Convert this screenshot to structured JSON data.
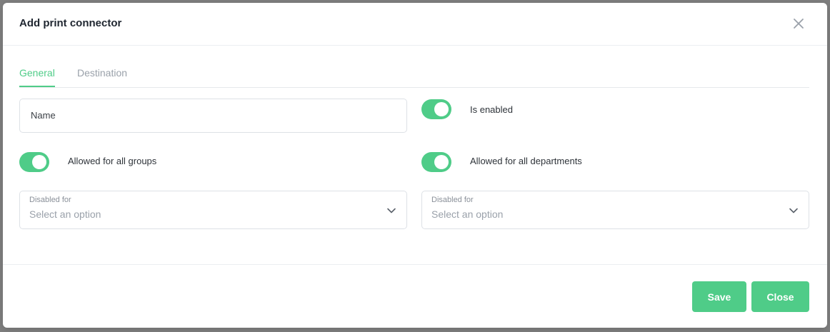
{
  "modal": {
    "title": "Add print connector"
  },
  "tabs": [
    {
      "label": "General",
      "active": true
    },
    {
      "label": "Destination",
      "active": false
    }
  ],
  "form": {
    "name_placeholder": "Name",
    "name_value": "",
    "toggles": {
      "is_enabled": {
        "label": "Is enabled",
        "on": true
      },
      "allowed_all_groups": {
        "label": "Allowed for all groups",
        "on": true
      },
      "allowed_all_departments": {
        "label": "Allowed for all departments",
        "on": true
      }
    },
    "groups_select": {
      "label": "Disabled for",
      "placeholder": "Select an option"
    },
    "departments_select": {
      "label": "Disabled for",
      "placeholder": "Select an option"
    }
  },
  "footer": {
    "save_label": "Save",
    "close_label": "Close"
  },
  "colors": {
    "accent": "#4fcc88",
    "title_text": "#1f2630",
    "muted_text": "#9aa1aa"
  },
  "icons": {
    "close": "close-icon",
    "dropdown": "chevron-down-icon"
  }
}
